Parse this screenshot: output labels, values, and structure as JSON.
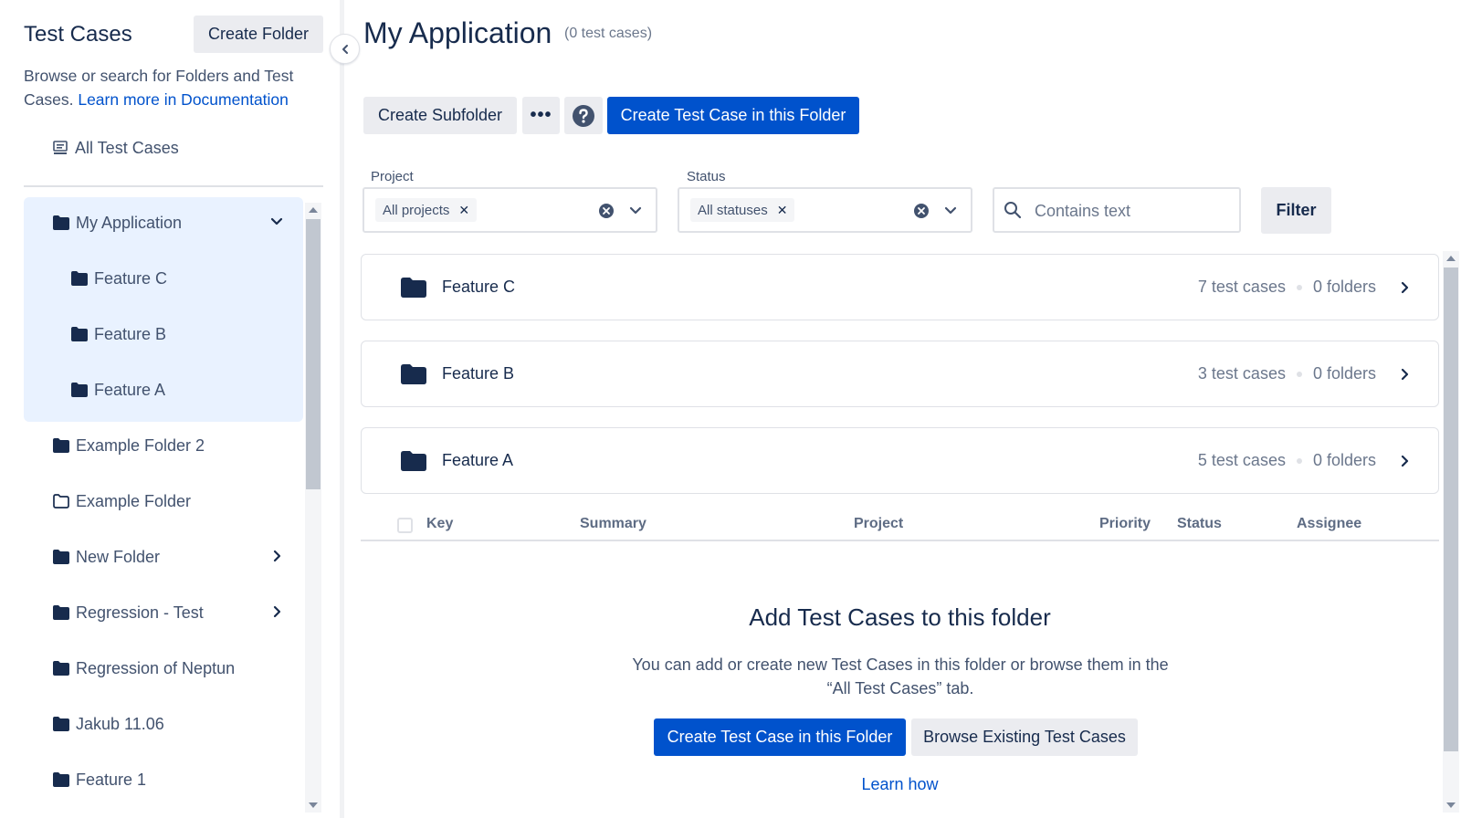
{
  "sidebar": {
    "title": "Test Cases",
    "create_folder_label": "Create Folder",
    "description_text": "Browse or search for Folders and Test Cases.",
    "description_link": "Learn more in Documentation",
    "all_test_cases_label": "All Test Cases",
    "tree": [
      {
        "label": "My Application",
        "icon": "folder-filled-icon",
        "expanded": true
      },
      {
        "label": "Feature C",
        "icon": "folder-filled-icon"
      },
      {
        "label": "Feature B",
        "icon": "folder-filled-icon"
      },
      {
        "label": "Feature A",
        "icon": "folder-filled-icon"
      },
      {
        "label": "Example Folder 2",
        "icon": "folder-filled-icon"
      },
      {
        "label": "Example Folder",
        "icon": "folder-outline-icon"
      },
      {
        "label": "New Folder",
        "icon": "folder-filled-icon",
        "has_children": true
      },
      {
        "label": "Regression - Test",
        "icon": "folder-filled-icon",
        "has_children": true
      },
      {
        "label": "Regression of Neptun",
        "icon": "folder-filled-icon"
      },
      {
        "label": "Jakub 11.06",
        "icon": "folder-filled-icon"
      },
      {
        "label": "Feature 1",
        "icon": "folder-filled-icon"
      }
    ]
  },
  "main": {
    "title": "My Application",
    "count_text": "(0 test cases)",
    "toolbar": {
      "create_subfolder_label": "Create Subfolder",
      "more_label": "•••",
      "help_icon": "question-circle-icon",
      "create_test_case_label": "Create Test Case in this Folder"
    },
    "filters": {
      "project_label": "Project",
      "project_chip": "All projects",
      "status_label": "Status",
      "status_chip": "All statuses",
      "search_placeholder": "Contains text",
      "filter_button": "Filter"
    },
    "folders": [
      {
        "name": "Feature C",
        "test_cases": "7 test cases",
        "folders": "0 folders"
      },
      {
        "name": "Feature B",
        "test_cases": "3 test cases",
        "folders": "0 folders"
      },
      {
        "name": "Feature A",
        "test_cases": "5 test cases",
        "folders": "0 folders"
      }
    ],
    "table_headers": {
      "key": "Key",
      "summary": "Summary",
      "project": "Project",
      "priority": "Priority",
      "status": "Status",
      "assignee": "Assignee"
    },
    "empty_state": {
      "title": "Add Test Cases to this folder",
      "description": "You can add or create new Test Cases in this folder or browse them in the “All Test Cases” tab.",
      "create_button": "Create Test Case in this Folder",
      "browse_button": "Browse Existing Test Cases",
      "learn_link": "Learn how"
    }
  },
  "colors": {
    "primary": "#0052cc",
    "text": "#172b4d",
    "subtle_text": "#42526e",
    "selected_bg": "#e9f2ff",
    "secondary_button_bg": "#ebecf0",
    "border": "#dfe1e6"
  }
}
